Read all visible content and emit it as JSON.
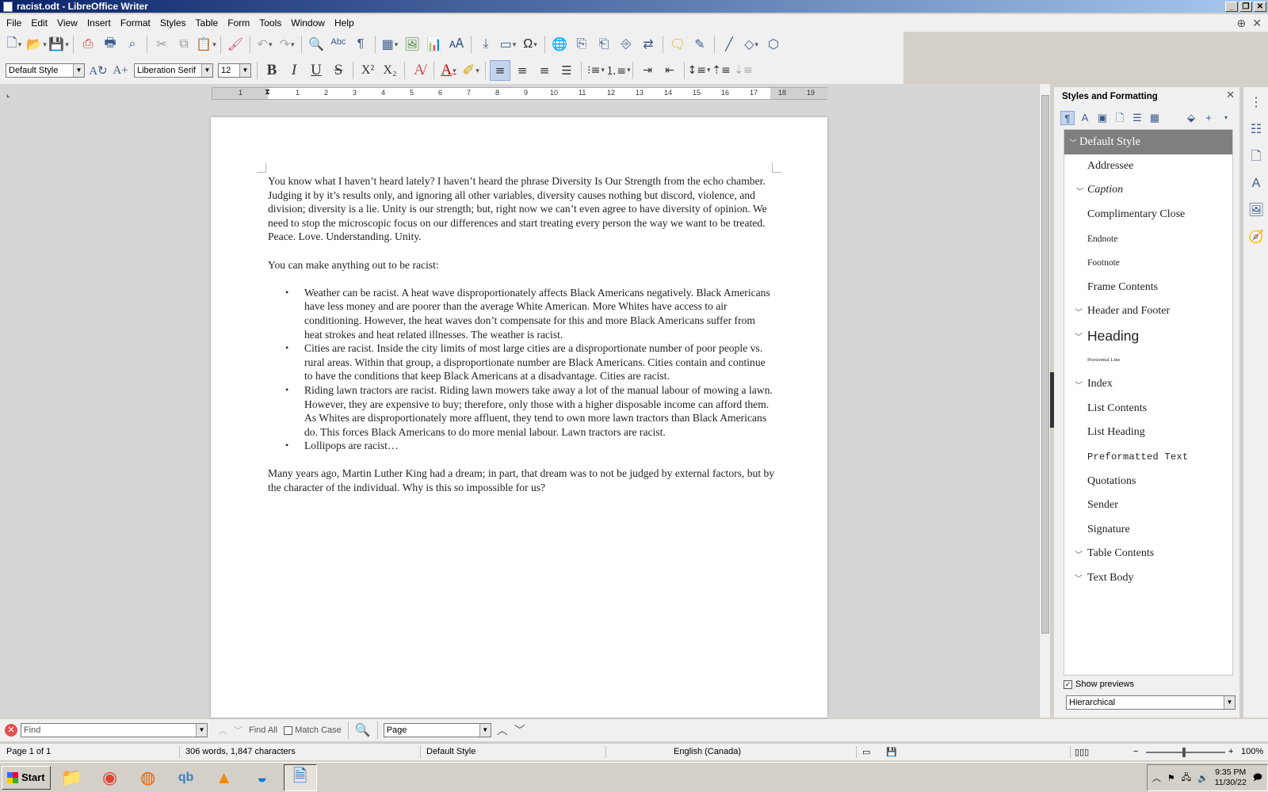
{
  "window": {
    "title": "racist.odt - LibreOffice Writer",
    "controls": [
      "_",
      "❐",
      "✕"
    ]
  },
  "menu": [
    "File",
    "Edit",
    "View",
    "Insert",
    "Format",
    "Styles",
    "Table",
    "Form",
    "Tools",
    "Window",
    "Help"
  ],
  "format_toolbar": {
    "paragraph_style": "Default Style",
    "font_name": "Liberation Serif",
    "font_size": "12",
    "colors": {
      "font_color": "#cc0000",
      "highlight": "#ffe800"
    }
  },
  "ruler": {
    "labels": [
      "1",
      "1",
      "1",
      "2",
      "3",
      "4",
      "5",
      "6",
      "7",
      "8",
      "9",
      "10",
      "11",
      "12",
      "13",
      "14",
      "15",
      "16",
      "17",
      "18",
      "19"
    ]
  },
  "document": {
    "para1": "You know what I haven’t heard lately?  I haven’t heard the phrase Diversity Is Our Strength from the echo chamber.  Judging it by it’s results only, and ignoring all other variables, diversity causes nothing but discord, violence, and division; diversity is a lie.  Unity is our strength; but, right now we can’t even agree to have diversity of opinion.  We need to stop the microscopic focus on our differences and start treating every person the way we want to be treated.  Peace.  Love.  Understanding.  Unity.",
    "para2": "You can make anything out to be racist:",
    "bullets": [
      "Weather can be racist.  A heat wave disproportionately affects Black Americans negatively.  Black Americans have less money and are poorer than the average White American.  More Whites have access to air conditioning.  However, the heat waves don’t compensate for this and more Black Americans suffer from heat strokes and heat related illnesses.  The weather is racist.",
      "Cities are racist.  Inside the city limits of most large cities are a disproportionate number of poor people vs. rural areas.  Within that group, a disproportionate number are Black Americans.  Cities contain and continue to have the conditions that keep Black Americans at a disadvantage.  Cities are racist.",
      "Riding lawn tractors are racist.  Riding lawn mowers take away a lot of the manual labour of mowing a lawn.  However, they are expensive to buy; therefore, only those with a higher disposable income can afford them.  As Whites are disproportionately more affluent, they tend to own more lawn tractors than Black Americans do.  This forces Black Americans to do more menial labour. Lawn tractors are racist.",
      "Lollipops are racist…"
    ],
    "para3": "Many years ago, Martin Luther King had a dream; in part, that dream was to not be judged by external factors, but by the character of the individual.  Why is this so impossible for us?"
  },
  "sidebar": {
    "title": "Styles and Formatting",
    "styles": [
      {
        "label": "Default Style",
        "expander": "﹀",
        "selected": true
      },
      {
        "label": "Addressee",
        "expander": ""
      },
      {
        "label": "Caption",
        "expander": "﹀"
      },
      {
        "label": "Complimentary Close",
        "expander": ""
      },
      {
        "label": "Endnote",
        "expander": ""
      },
      {
        "label": "Footnote",
        "expander": ""
      },
      {
        "label": "Frame Contents",
        "expander": ""
      },
      {
        "label": "Header and Footer",
        "expander": "﹀"
      },
      {
        "label": "Heading",
        "expander": "﹀"
      },
      {
        "label": "Horizontal Line",
        "expander": ""
      },
      {
        "label": "Index",
        "expander": "﹀"
      },
      {
        "label": "List Contents",
        "expander": ""
      },
      {
        "label": "List Heading",
        "expander": ""
      },
      {
        "label": "Preformatted Text",
        "expander": ""
      },
      {
        "label": "Quotations",
        "expander": ""
      },
      {
        "label": "Sender",
        "expander": ""
      },
      {
        "label": "Signature",
        "expander": ""
      },
      {
        "label": "Table Contents",
        "expander": "﹀"
      },
      {
        "label": "Text Body",
        "expander": "﹀"
      }
    ],
    "show_previews_label": "Show previews",
    "show_previews_checked": true,
    "filter_value": "Hierarchical"
  },
  "findbar": {
    "placeholder": "Find",
    "find_all": "Find All",
    "match_case": "Match Case",
    "search_scope": "Page"
  },
  "statusbar": {
    "page": "Page 1 of 1",
    "words": "306 words, 1,847 characters",
    "page_style": "Default Style",
    "language": "English (Canada)",
    "zoom": "100%"
  },
  "taskbar": {
    "start_label": "Start",
    "time": "9:35 PM",
    "date": "11/30/22"
  }
}
